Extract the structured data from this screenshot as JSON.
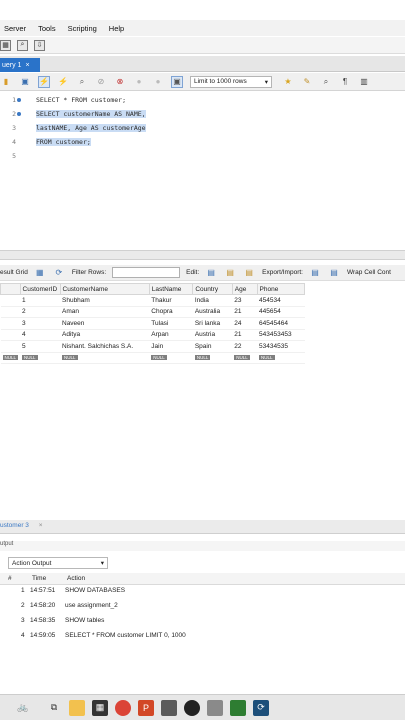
{
  "menu": [
    "Server",
    "Tools",
    "Scripting",
    "Help"
  ],
  "tab": {
    "label": "uery 1",
    "close": "×"
  },
  "toolbar": {
    "limit_label": "Limit to 1000 rows"
  },
  "editor": {
    "line_numbers": [
      "1",
      "2",
      "3",
      "4",
      "5"
    ],
    "lines": [
      {
        "text": "SELECT * FROM customer;"
      },
      {
        "text": "SELECT customerName AS NAME,"
      },
      {
        "text": "lastNAME, Age AS customerAge"
      },
      {
        "text": "FROM customer;"
      },
      {
        "text": ""
      }
    ]
  },
  "result_bar": {
    "result_grid": "esult Grid",
    "filter_rows": "Filter Rows:",
    "edit": "Edit:",
    "export_import": "Export/Import:",
    "wrap": "Wrap Cell Cont"
  },
  "grid": {
    "columns": [
      "CustomerID",
      "CustomerName",
      "LastName",
      "Country",
      "Age",
      "Phone"
    ],
    "rows": [
      [
        "1",
        "Shubham",
        "Thakur",
        "India",
        "23",
        "454534"
      ],
      [
        "2",
        "Aman",
        "Chopra",
        "Australia",
        "21",
        "445654"
      ],
      [
        "3",
        "Naveen",
        "Tulasi",
        "Sri lanka",
        "24",
        "64545464"
      ],
      [
        "4",
        "Aditya",
        "Arpan",
        "Austria",
        "21",
        "543453453"
      ],
      [
        "5",
        "Nishant. Salchichas S.A.",
        "Jain",
        "Spain",
        "22",
        "53434535"
      ]
    ],
    "null_label": "NULL"
  },
  "output_tabs": {
    "tab": "ustomer 3",
    "close": "×"
  },
  "output": {
    "label": "utput",
    "dropdown": "Action Output",
    "headers": {
      "num": "#",
      "time": "Time",
      "action": "Action"
    },
    "rows": [
      {
        "num": "1",
        "time": "14:57:51",
        "action": "SHOW DATABASES"
      },
      {
        "num": "2",
        "time": "14:58:20",
        "action": "use assignment_2"
      },
      {
        "num": "3",
        "time": "14:58:35",
        "action": "SHOW tables"
      },
      {
        "num": "4",
        "time": "14:59:05",
        "action": "SELECT * FROM customer LIMIT 0, 1000"
      }
    ]
  },
  "colors": {
    "accent": "#2a73c9",
    "selection": "#c9dcf4"
  }
}
